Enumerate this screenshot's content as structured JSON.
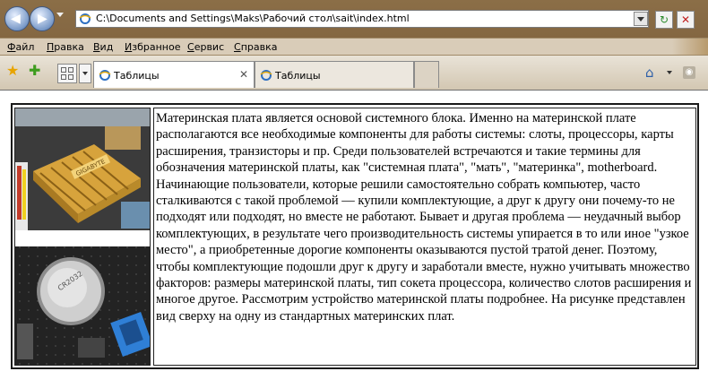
{
  "browser": {
    "address": "C:\\Documents and Settings\\Maks\\Рабочий стол\\sait\\index.html",
    "menu": [
      "Файл",
      "Правка",
      "Вид",
      "Избранное",
      "Сервис",
      "Справка"
    ],
    "menu_accel": [
      "Ф",
      "П",
      "В",
      "И",
      "С",
      "С"
    ],
    "tabs": [
      {
        "label": "Таблицы",
        "active": true
      },
      {
        "label": "Таблицы",
        "active": false
      }
    ]
  },
  "page": {
    "paragraph": "Материнская плата является основой системного блока. Именно на материнской плате располагаются все необходимые компоненты для работы системы: слоты, процессоры, карты расширения, транзисторы и пр. Среди пользователей встречаются и такие термины для обозначения материнской платы, как \"системная плата\", \"мать\", \"материнка\", motherboard. Начинающие пользователи, которые решили самостоятельно собрать компьютер, часто сталкиваются с такой проблемой — купили комплектующие, а друг к другу они почему-то не подходят или подходят, но вместе не работают. Бывает и другая проблема — неудачный выбор комплектующих, в результате чего производительность системы упирается в то или иное \"узкое место\", а приобретенные дорогие компоненты оказываются пустой тратой денег. Поэтому, чтобы комплектующие подошли друг к другу и заработали вместе, нужно учитывать множество факторов: размеры материнской платы, тип сокета процессора, количество слотов расширения и многое другое. Рассмотрим устройство материнской платы подробнее. На рисунке представлен вид сверху на одну из стандартных материнских плат.",
    "image_top_brand": "GIGABYTE",
    "image_bottom_mark": "CR2032"
  },
  "colors": {
    "chrome": "#8b6e47",
    "menubar": "#d9ccb8",
    "tabbar": "#e4ddcf",
    "heatsink": "#d7a33c",
    "board": "#2b2b2b",
    "sata": "#2f7fd6"
  },
  "icons": {
    "back": "arrow-left-icon",
    "forward": "arrow-right-icon",
    "refresh": "refresh-icon",
    "stop": "close-icon",
    "favorites": "star-icon",
    "add_favorite": "star-plus-icon",
    "home": "home-icon",
    "rss": "rss-icon"
  }
}
